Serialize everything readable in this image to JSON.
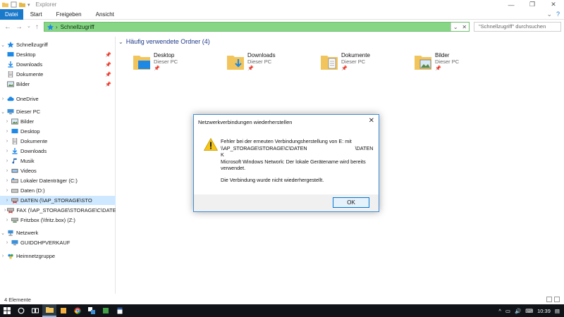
{
  "window": {
    "title": "Explorer"
  },
  "ribbon": {
    "tabs": [
      "Datei",
      "Start",
      "Freigeben",
      "Ansicht"
    ]
  },
  "address": {
    "path": "Schnellzugriff",
    "search_placeholder": "\"Schnellzugriff\" durchsuchen"
  },
  "sidebar": {
    "items": [
      {
        "label": "Schnellzugriff",
        "icon": "star-icon",
        "pinned": false
      },
      {
        "label": "Desktop",
        "icon": "desktop-folder-icon",
        "pinned": true
      },
      {
        "label": "Downloads",
        "icon": "download-icon",
        "pinned": true
      },
      {
        "label": "Dokumente",
        "icon": "documents-icon",
        "pinned": true
      },
      {
        "label": "Bilder",
        "icon": "pictures-icon",
        "pinned": true
      },
      {
        "label": "OneDrive",
        "icon": "cloud-icon"
      },
      {
        "label": "Dieser PC",
        "icon": "computer-icon"
      },
      {
        "label": "Bilder",
        "icon": "pictures-icon"
      },
      {
        "label": "Desktop",
        "icon": "desktop-folder-icon"
      },
      {
        "label": "Dokumente",
        "icon": "documents-icon"
      },
      {
        "label": "Downloads",
        "icon": "download-icon"
      },
      {
        "label": "Musik",
        "icon": "music-icon"
      },
      {
        "label": "Videos",
        "icon": "video-icon"
      },
      {
        "label": "Lokaler Datenträger (C:)",
        "icon": "drive-icon"
      },
      {
        "label": "Daten (D:)",
        "icon": "drive-icon"
      },
      {
        "label": "DATEN (\\\\AP_STORAGE\\STO",
        "icon": "network-drive-disconnected-icon"
      },
      {
        "label": "FAX (\\\\AP_STORAGE\\STORAGE\\C\\DATEN\\",
        "icon": "network-drive-disconnected-icon"
      },
      {
        "label": "Fritzbox (\\\\fritz.box) (Z:)",
        "icon": "network-drive-icon"
      },
      {
        "label": "Netzwerk",
        "icon": "network-icon"
      },
      {
        "label": "GUIDOHPVERKAUF",
        "icon": "computer-icon"
      },
      {
        "label": "Heimnetzgruppe",
        "icon": "homegroup-icon"
      }
    ]
  },
  "main": {
    "group_title": "Häufig verwendete Ordner (4)",
    "folders": [
      {
        "name": "Desktop",
        "location": "Dieser PC"
      },
      {
        "name": "Downloads",
        "location": "Dieser PC"
      },
      {
        "name": "Dokumente",
        "location": "Dieser PC"
      },
      {
        "name": "Bilder",
        "location": "Dieser PC"
      }
    ]
  },
  "status": {
    "count": "4 Elemente"
  },
  "taskbar": {
    "time": "10:39"
  },
  "dialog": {
    "title": "Netzwerkverbindungen wiederherstellen",
    "line1": "Fehler bei der erneuten Verbindungsherstellung von E: mit",
    "line2": "\\\\AP_STORAGE\\STORAGE\\C\\DATEN",
    "line2b": "\\DATEN",
    "line3": "K",
    "line4": "Microsoft Windows Network: Der lokale Gerätename wird bereits",
    "line5": "verwendet.",
    "line6": "Die Verbindung wurde nicht wiederhergestellt.",
    "ok_label": "OK"
  },
  "colors": {
    "accent": "#1979ca",
    "address_bar": "#86d686",
    "selection": "#cde8ff",
    "folder": "#f2c55c"
  }
}
